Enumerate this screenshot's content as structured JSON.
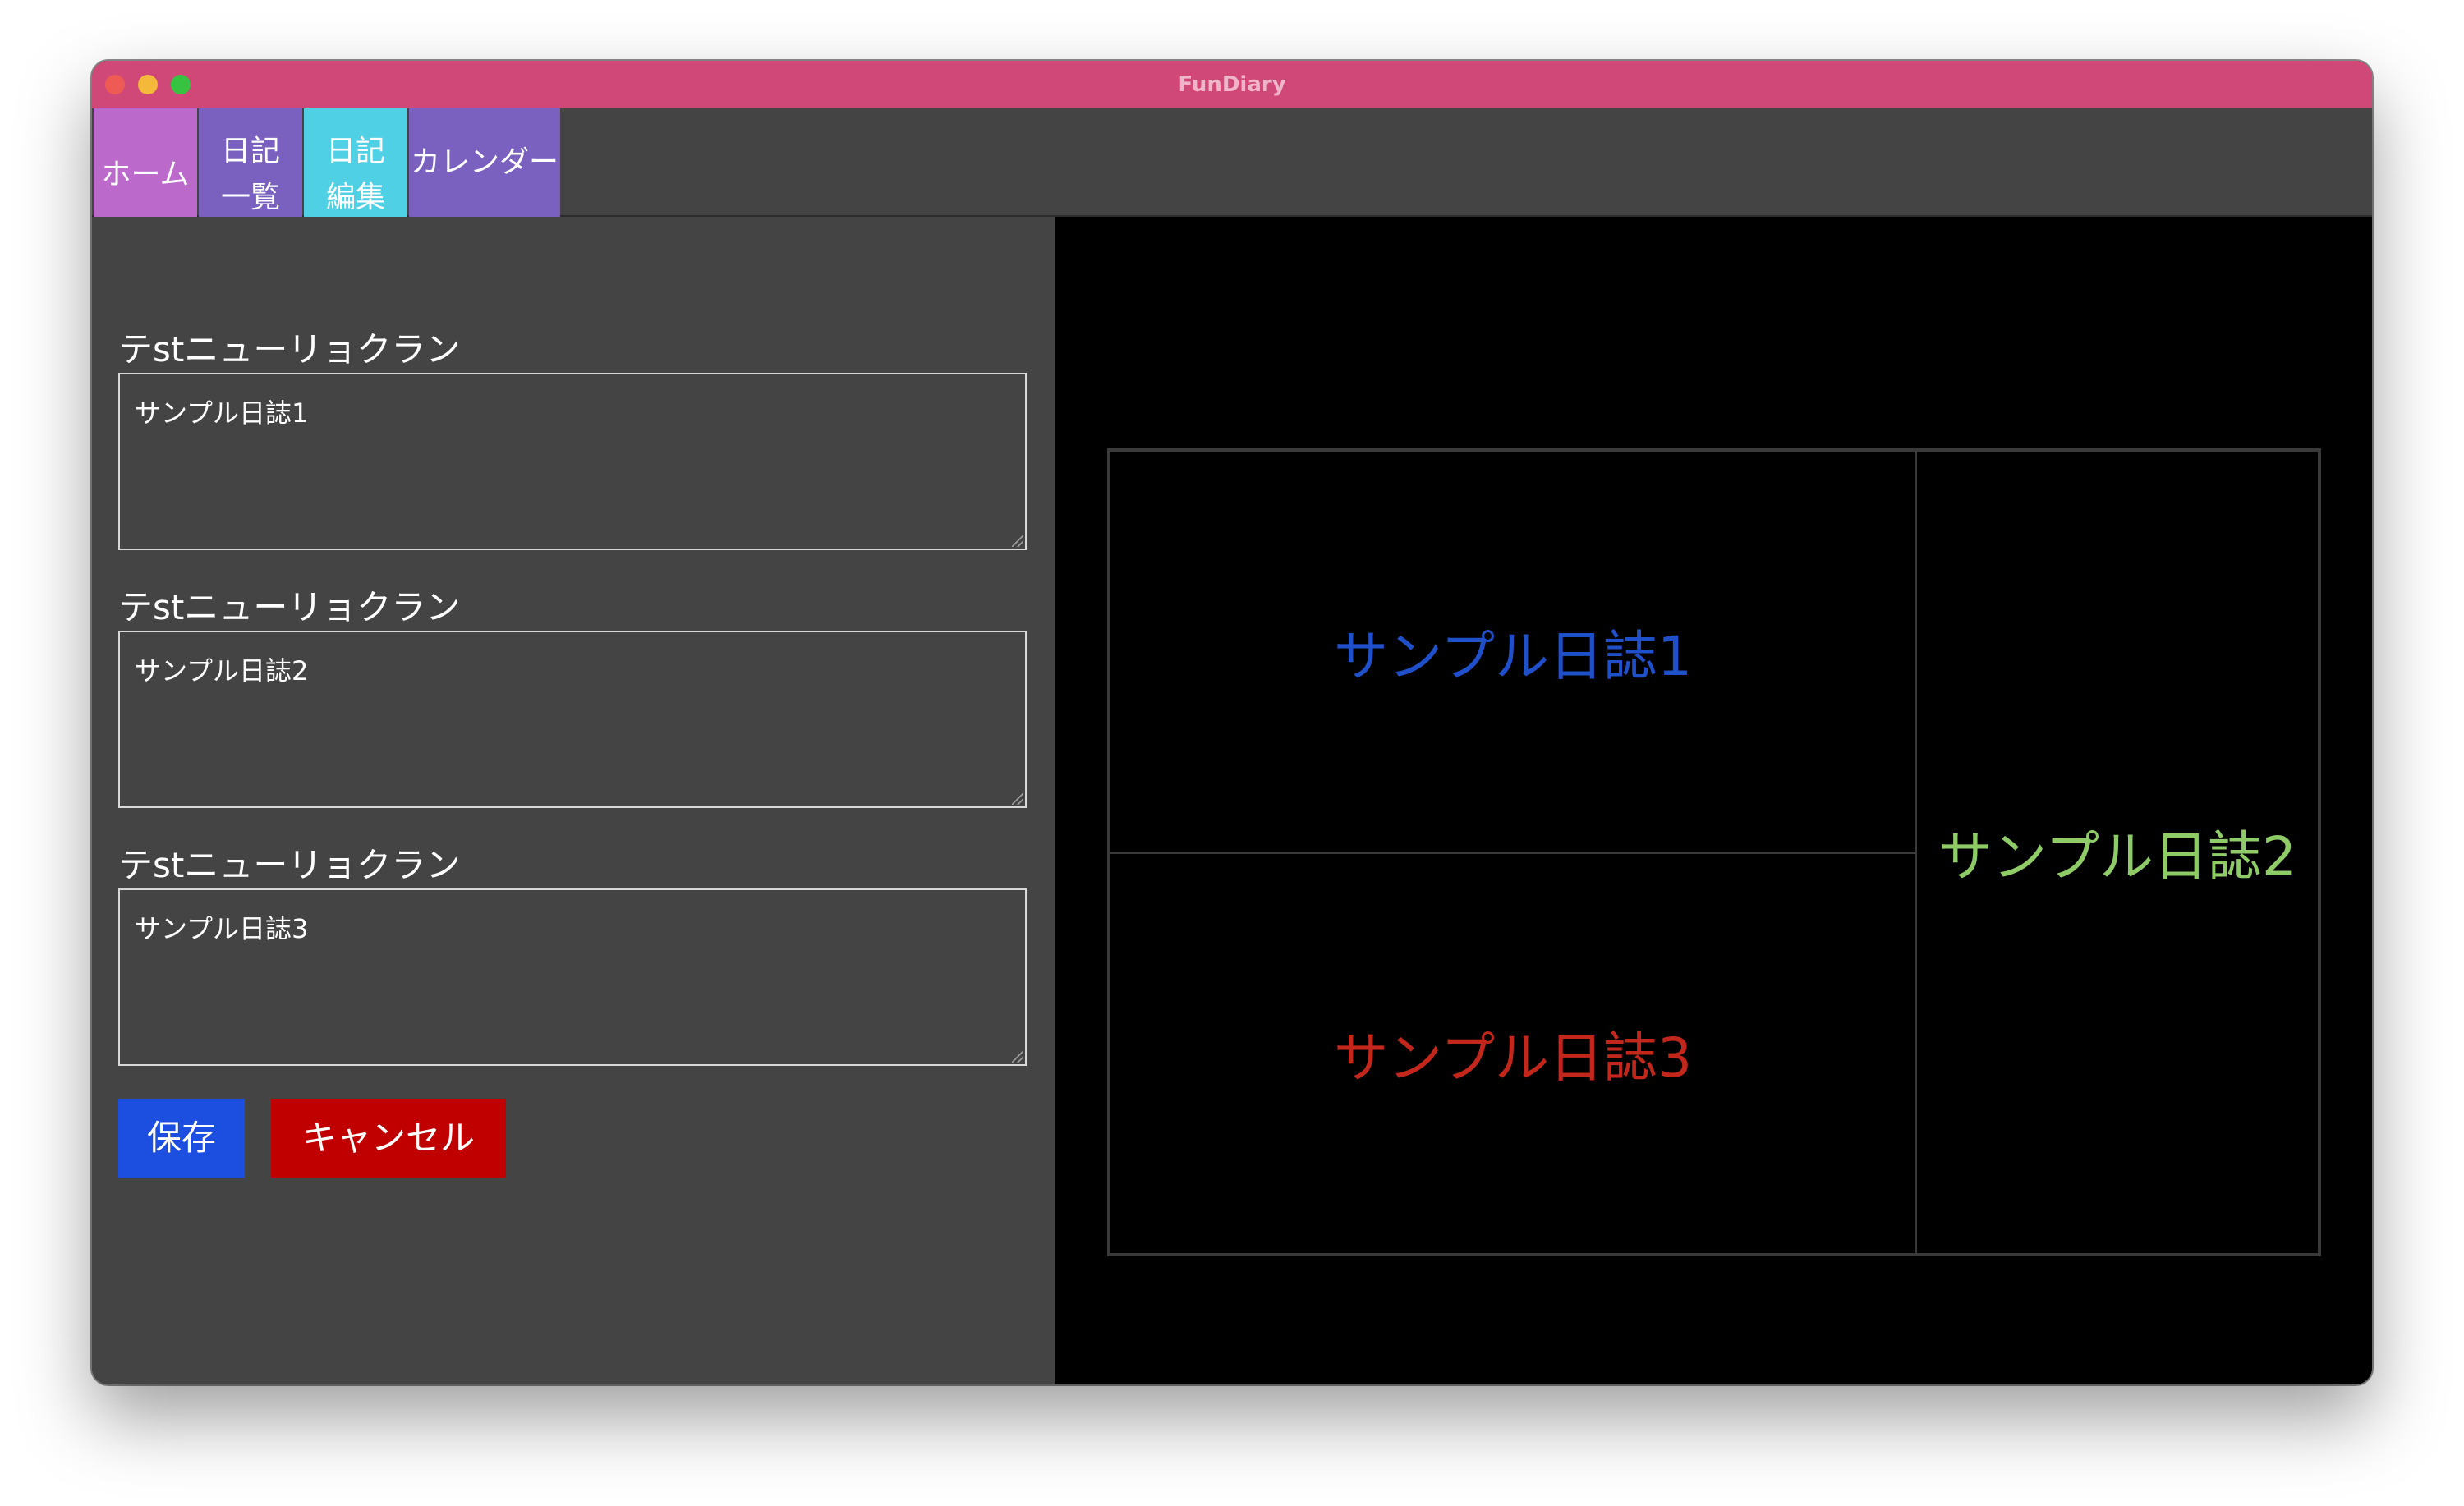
{
  "window": {
    "title": "FunDiary"
  },
  "tabs": [
    {
      "label_line1": "ホーム",
      "label_line2": "",
      "color": "#bb6acc"
    },
    {
      "label_line1": "日記",
      "label_line2": "一覧",
      "color": "#7a60bf"
    },
    {
      "label_line1": "日記",
      "label_line2": "編集",
      "color": "#4fd0e4"
    },
    {
      "label_line1": "カレンダー",
      "label_line2": "",
      "color": "#7a60bf"
    }
  ],
  "editor": {
    "fields": [
      {
        "label": "テstニューリョクラン",
        "value": "サンプル日誌1"
      },
      {
        "label": "テstニューリョクラン",
        "value": "サンプル日誌2"
      },
      {
        "label": "テstニューリョクラン",
        "value": "サンプル日誌3"
      }
    ],
    "save_label": "保存",
    "cancel_label": "キャンセル"
  },
  "preview": {
    "cells": [
      {
        "text": "サンプル日誌1",
        "color": "#1f4fc9"
      },
      {
        "text": "サンプル日誌2",
        "color": "#8fcc68"
      },
      {
        "text": "サンプル日誌3",
        "color": "#c3261b"
      }
    ]
  },
  "colors": {
    "titlebar": "#cf4877",
    "panel_bg": "#444444",
    "preview_bg": "#000000",
    "save_button": "#1c4fe0",
    "cancel_button": "#c00000"
  }
}
